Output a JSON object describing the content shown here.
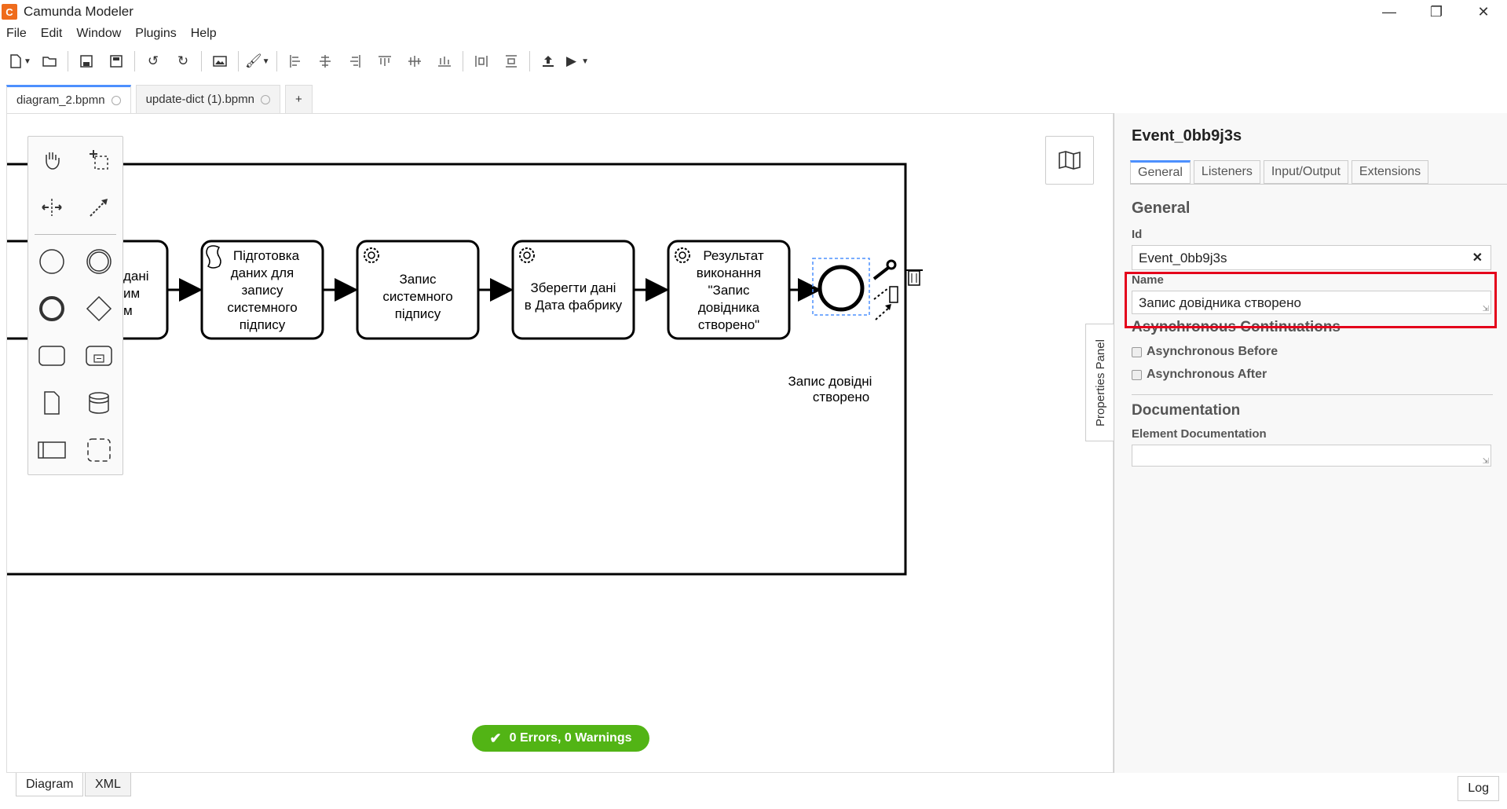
{
  "app": {
    "title": "Camunda Modeler"
  },
  "menu": [
    "File",
    "Edit",
    "Window",
    "Plugins",
    "Help"
  ],
  "window_controls": [
    "minimize-icon",
    "restore-icon",
    "close-icon"
  ],
  "toolbar_icons": [
    "new-file-icon",
    "open-folder-icon",
    "save-icon",
    "save-as-icon",
    "undo-icon",
    "redo-icon",
    "image-export-icon",
    "color-brush-icon",
    "align-left-icon",
    "align-center-icon",
    "align-right-icon",
    "align-top-icon",
    "align-middle-icon",
    "align-bottom-icon",
    "distribute-horizontal-icon",
    "distribute-vertical-icon",
    "deploy-icon",
    "run-icon"
  ],
  "tabs": [
    {
      "label": "diagram_2.bpmn",
      "active": true
    },
    {
      "label": "update-dict (1).bpmn",
      "active": false
    },
    {
      "label": "+",
      "active": false
    }
  ],
  "diagram": {
    "partial_task_text": [
      "дані",
      "им",
      "м"
    ],
    "tasks": [
      {
        "icon": "script-icon",
        "lines": [
          "Підготовка",
          "даних для",
          "запису",
          "системного",
          "підпису"
        ]
      },
      {
        "icon": "service-gear-icon",
        "lines": [
          "Запис",
          "системного",
          "підпису"
        ]
      },
      {
        "icon": "service-gear-icon",
        "lines": [
          "Зберегти дані",
          "в Дата фабрику"
        ]
      },
      {
        "icon": "service-gear-icon",
        "lines": [
          "Результат",
          "виконання",
          "\"Запис",
          "довідника",
          "створено\""
        ]
      }
    ],
    "end_event_label": [
      "Запис довідні",
      "створено"
    ]
  },
  "status": {
    "text": "0 Errors, 0 Warnings",
    "color": "#52b415"
  },
  "properties_panel": {
    "toggle_label": "Properties Panel",
    "element_id_title": "Event_0bb9j3s",
    "tabs": [
      "General",
      "Listeners",
      "Input/Output",
      "Extensions"
    ],
    "active_tab": "General",
    "general_heading": "General",
    "id_label": "Id",
    "id_value": "Event_0bb9j3s",
    "name_label": "Name",
    "name_value": "Запис довідника створено",
    "async_heading": "Asynchronous Continuations",
    "async_before": "Asynchronous Before",
    "async_after": "Asynchronous After",
    "doc_heading": "Documentation",
    "doc_label": "Element Documentation",
    "doc_value": ""
  },
  "bottom_tabs": [
    "Diagram",
    "XML"
  ],
  "log_button": "Log",
  "colors": {
    "accent": "#4d90fe",
    "highlight": "#e4001b",
    "success": "#52b415"
  }
}
